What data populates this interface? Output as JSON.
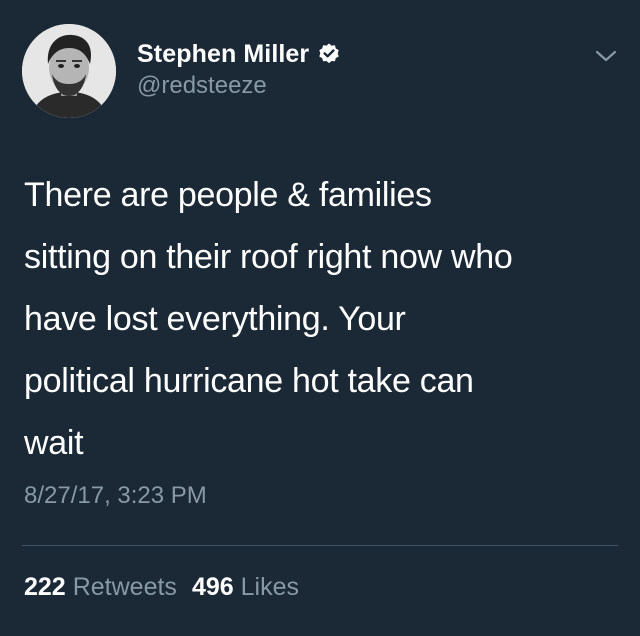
{
  "user": {
    "display_name": "Stephen Miller",
    "handle": "@redsteeze",
    "verified": true
  },
  "tweet": {
    "lines": [
      "There are people & families",
      "sitting on their roof right now who",
      "have lost everything. Your",
      "political hurricane hot take can",
      "wait"
    ],
    "timestamp": "8/27/17, 3:23 PM"
  },
  "stats": {
    "retweets_count": "222",
    "retweets_label": "Retweets",
    "likes_count": "496",
    "likes_label": "Likes"
  },
  "colors": {
    "background": "#1b2836",
    "text_primary": "#ffffff",
    "text_secondary": "#8899a6",
    "divider": "#3d5466"
  },
  "icons": [
    "verified-badge-icon",
    "chevron-down-icon"
  ]
}
